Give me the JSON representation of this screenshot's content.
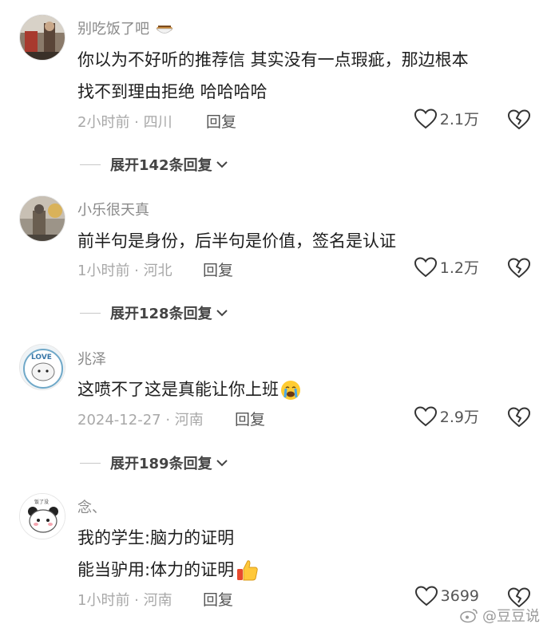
{
  "comments": [
    {
      "username": "别吃饭了吧",
      "lines": [
        "你以为不好听的推荐信 其实没有一点瑕疵，那边根本",
        "找不到理由拒绝 哈哈哈哈"
      ],
      "meta": "2小时前 · 四川",
      "reply_label": "回复",
      "likes": "2.1万",
      "expand_label": "展开142条回复",
      "avatar_icon": "photo-avatar-icon",
      "username_emoji_icon": "food-bowl-icon"
    },
    {
      "username": "小乐很天真",
      "lines": [
        "前半句是身份，后半句是价值，签名是认证"
      ],
      "meta": "1小时前 · 河北",
      "reply_label": "回复",
      "likes": "1.2万",
      "expand_label": "展开128条回复",
      "avatar_icon": "photo-avatar-icon"
    },
    {
      "username": "兆泽",
      "lines": [
        "这喷不了这是真能让你上班"
      ],
      "meta": "2024-12-27 · 河南",
      "reply_label": "回复",
      "likes": "2.9万",
      "expand_label": "展开189条回复",
      "avatar_icon": "cartoon-love-avatar-icon",
      "avatar_text": "LOVE",
      "trailing_emoji_icon": "crying-face-icon"
    },
    {
      "username": "念、",
      "lines": [
        "我的学生:脑力的证明",
        "能当驴用:体力的证明"
      ],
      "meta": "1小时前 · 河南",
      "reply_label": "回复",
      "likes": "3699",
      "avatar_icon": "panda-avatar-icon",
      "avatar_text": "饭了没",
      "trailing_emoji_icon": "thumbs-up-icon"
    }
  ],
  "watermark": "@豆豆说",
  "colors": {
    "text": "#1e1e1e",
    "meta": "#a8a8a8",
    "username": "#8a8a8a"
  }
}
